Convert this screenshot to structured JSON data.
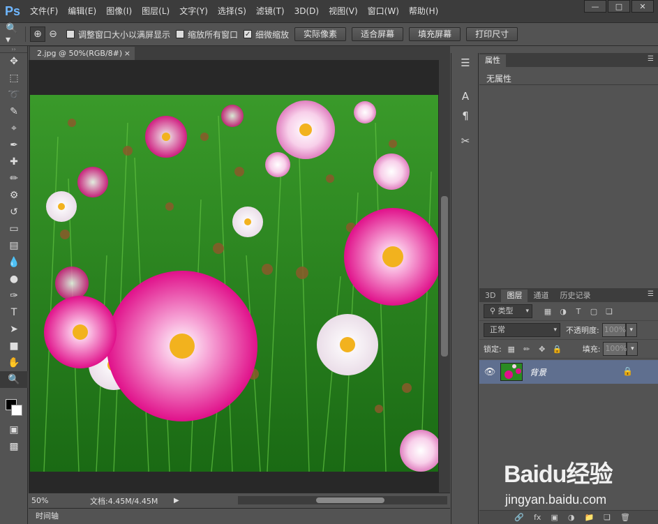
{
  "app": {
    "logo": "Ps",
    "menu": [
      "文件(F)",
      "编辑(E)",
      "图像(I)",
      "图层(L)",
      "文字(Y)",
      "选择(S)",
      "滤镜(T)",
      "3D(D)",
      "视图(V)",
      "窗口(W)",
      "帮助(H)"
    ],
    "window_controls": [
      "minimize",
      "maximize",
      "close"
    ]
  },
  "options": {
    "checkbox1": "调整窗口大小以满屏显示",
    "checkbox2": "缩放所有窗口",
    "checkbox3": "细微缩放",
    "checkbox3_checked": true,
    "buttons": [
      "实际像素",
      "适合屏幕",
      "填充屏幕",
      "打印尺寸"
    ]
  },
  "tools": [
    "move-icon",
    "marquee-icon",
    "lasso-icon",
    "quick-select-icon",
    "crop-icon",
    "eyedropper-icon",
    "healing-icon",
    "brush-icon",
    "stamp-icon",
    "history-brush-icon",
    "eraser-icon",
    "gradient-icon",
    "blur-icon",
    "dodge-icon",
    "pen-icon",
    "type-icon",
    "path-select-icon",
    "shape-icon",
    "hand-icon",
    "zoom-icon"
  ],
  "document": {
    "tab_title": "2.jpg @ 50%(RGB/8#)",
    "zoom": "50%",
    "doc_info": "文档:4.45M/4.45M",
    "timeline": "时间轴"
  },
  "properties": {
    "tab": "属性",
    "body": "无属性"
  },
  "layers": {
    "tabs": [
      "3D",
      "图层",
      "通道",
      "历史记录"
    ],
    "active_tab": "图层",
    "filter_kind": "类型",
    "blend_mode": "正常",
    "opacity_label": "不透明度:",
    "opacity_value": "100%",
    "lock_label": "锁定:",
    "fill_label": "填充:",
    "fill_value": "100%",
    "layer_name": "背景"
  },
  "watermark": {
    "brand": "Baidu经验",
    "url": "jingyan.baidu.com"
  },
  "colors": {
    "accent": "#6fb7ff",
    "layer_selected": "#5f6f8f",
    "panel_bg": "#535353",
    "dark_bg": "#282828"
  }
}
